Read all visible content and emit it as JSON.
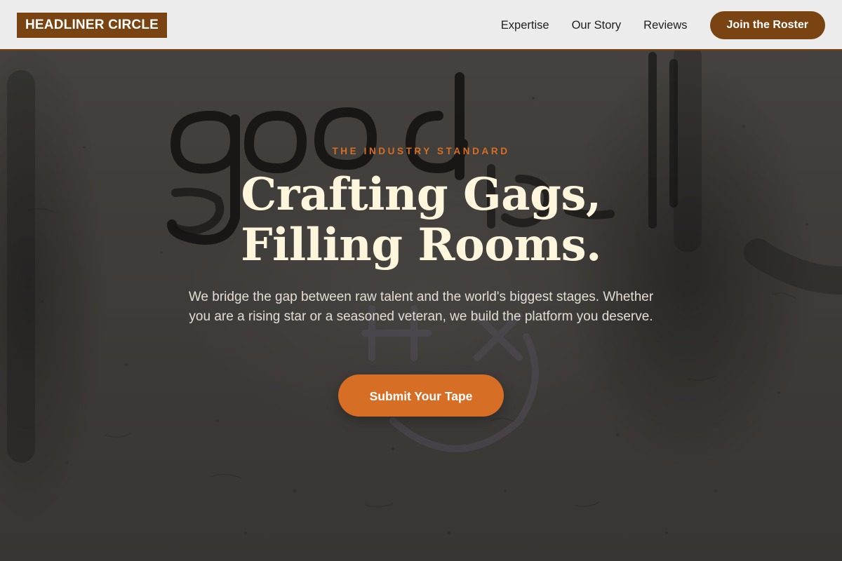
{
  "brand": {
    "name": "HEADLINER CIRCLE"
  },
  "nav": {
    "links": [
      "Expertise",
      "Our Story",
      "Reviews"
    ],
    "cta_label": "Join the Roster"
  },
  "hero": {
    "eyebrow": "THE INDUSTRY STANDARD",
    "headline_line1": "Crafting Gags,",
    "headline_line2": "Filling Rooms.",
    "description": "We bridge the gap between raw talent and the world's biggest stages. Whether you are a rising star or a seasoned veteran, we build the platform you deserve.",
    "cta_label": "Submit Your Tape"
  },
  "colors": {
    "brand_brown": "#7a4412",
    "accent_orange": "#d66e25",
    "headline_cream": "#fdf6dc",
    "header_bg": "#f4f4f4"
  }
}
